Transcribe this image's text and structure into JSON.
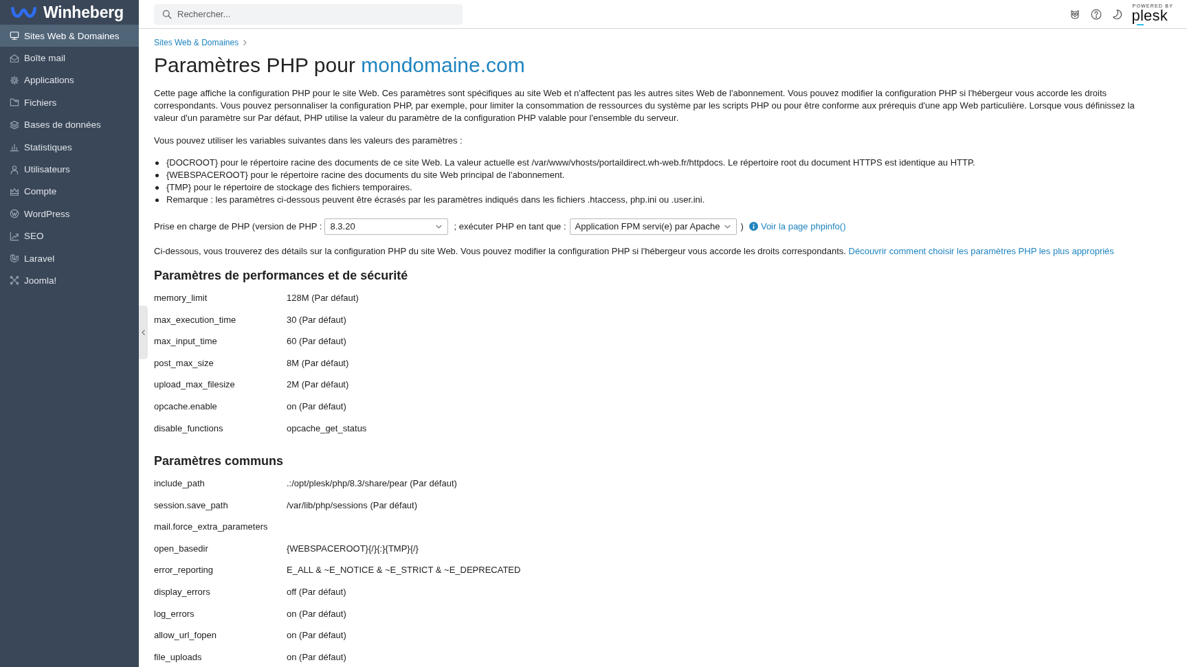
{
  "sidebar": {
    "brand": "Winheberg",
    "items": [
      {
        "label": "Sites Web & Domaines",
        "selected": true
      },
      {
        "label": "Boîte mail",
        "selected": false
      },
      {
        "label": "Applications",
        "selected": false
      },
      {
        "label": "Fichiers",
        "selected": false
      },
      {
        "label": "Bases de données",
        "selected": false
      },
      {
        "label": "Statistiques",
        "selected": false
      },
      {
        "label": "Utilisateurs",
        "selected": false
      },
      {
        "label": "Compte",
        "selected": false
      },
      {
        "label": "WordPress",
        "selected": false
      },
      {
        "label": "SEO",
        "selected": false
      },
      {
        "label": "Laravel",
        "selected": false
      },
      {
        "label": "Joomla!",
        "selected": false
      }
    ]
  },
  "top_bar": {
    "search": {
      "placeholder": "Rechercher..."
    },
    "powered_by": "POWERED BY",
    "product": "plesk"
  },
  "breadcrumb": [
    {
      "label": "Sites Web & Domaines"
    }
  ],
  "page": {
    "title": "Paramètres PHP pour",
    "title_link": "mondomaine.com",
    "intro": "Cette page affiche la configuration PHP pour le site Web. Ces paramètres sont spécifiques au site Web et n'affectent pas les autres sites Web de l'abonnement. Vous pouvez modifier la configuration PHP si l'hébergeur vous accorde les droits correspondants. Vous pouvez personnaliser la configuration PHP, par exemple, pour limiter la consommation de ressources du système par les scripts PHP ou pour être conforme aux prérequis d'une app Web particulière. Lorsque vous définissez la valeur d'un paramètre sur Par défaut, PHP utilise la valeur du paramètre de la configuration PHP valable pour l'ensemble du serveur.",
    "variables_intro": "Vous pouvez utiliser les variables suivantes dans les valeurs des paramètres :",
    "variables": [
      "{DOCROOT} pour le répertoire racine des documents de ce site Web. La valeur actuelle est /var/www/vhosts/portaildirect.wh-web.fr/httpdocs. Le répertoire root du document HTTPS est identique au HTTP.",
      "{WEBSPACEROOT} pour le répertoire racine des documents du site Web principal de l'abonnement.",
      "{TMP} pour le répertoire de stockage des fichiers temporaires.",
      "Remarque : les paramètres ci-dessous peuvent être écrasés par les paramètres indiqués dans les fichiers .htaccess, php.ini ou .user.ini."
    ],
    "php_support": {
      "label": "Prise en charge de PHP (version de PHP :",
      "version": "8.3.20",
      "run_as_label": "; exécuter PHP en tant que :",
      "handler": "Application FPM servi(e) par Apache",
      "close": ")",
      "phpinfo_link": "Voir la page phpinfo()"
    },
    "details": {
      "text": "Ci-dessous, vous trouverez des détails sur la configuration PHP du site Web. Vous pouvez modifier la configuration PHP si l'hébergeur vous accorde les droits correspondants.",
      "link": "Découvrir comment choisir les paramètres PHP les plus appropriés"
    },
    "sections": [
      {
        "title": "Paramètres de performances et de sécurité",
        "settings": [
          {
            "name": "memory_limit",
            "value": "128M (Par défaut)"
          },
          {
            "name": "max_execution_time",
            "value": "30 (Par défaut)"
          },
          {
            "name": "max_input_time",
            "value": "60 (Par défaut)"
          },
          {
            "name": "post_max_size",
            "value": "8M (Par défaut)"
          },
          {
            "name": "upload_max_filesize",
            "value": "2M (Par défaut)"
          },
          {
            "name": "opcache.enable",
            "value": "on (Par défaut)"
          },
          {
            "name": "disable_functions",
            "value": "opcache_get_status"
          }
        ]
      },
      {
        "title": "Paramètres communs",
        "settings": [
          {
            "name": "include_path",
            "value": ".:/opt/plesk/php/8.3/share/pear (Par défaut)"
          },
          {
            "name": "session.save_path",
            "value": "/var/lib/php/sessions (Par défaut)"
          },
          {
            "name": "mail.force_extra_parameters"
          },
          {
            "name": "open_basedir",
            "value": "{WEBSPACEROOT}{/}{:}{TMP}{/}"
          },
          {
            "name": "error_reporting",
            "value": "E_ALL & ~E_NOTICE & ~E_STRICT & ~E_DEPRECATED"
          },
          {
            "name": "display_errors",
            "value": "off (Par défaut)"
          },
          {
            "name": "log_errors",
            "value": "on (Par défaut)"
          },
          {
            "name": "allow_url_fopen",
            "value": "on (Par défaut)"
          },
          {
            "name": "file_uploads",
            "value": "on (Par défaut)"
          }
        ]
      }
    ]
  }
}
